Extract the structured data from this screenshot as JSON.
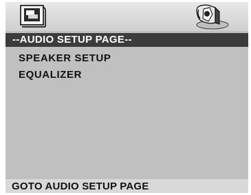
{
  "icons": {
    "general_setup": "general-setup-icon",
    "audio_setup": "audio-setup-icon"
  },
  "page": {
    "header": "--AUDIO  SETUP PAGE--"
  },
  "menu": {
    "items": [
      {
        "label": "SPEAKER SETUP"
      },
      {
        "label": "EQUALIZER"
      }
    ]
  },
  "footer": {
    "status": "GOTO AUDIO SETUP PAGE"
  },
  "colors": {
    "screen_bg": "#c0c0c0",
    "header_bg": "#3c3c3c",
    "footer_bg": "#d9d9d9"
  }
}
